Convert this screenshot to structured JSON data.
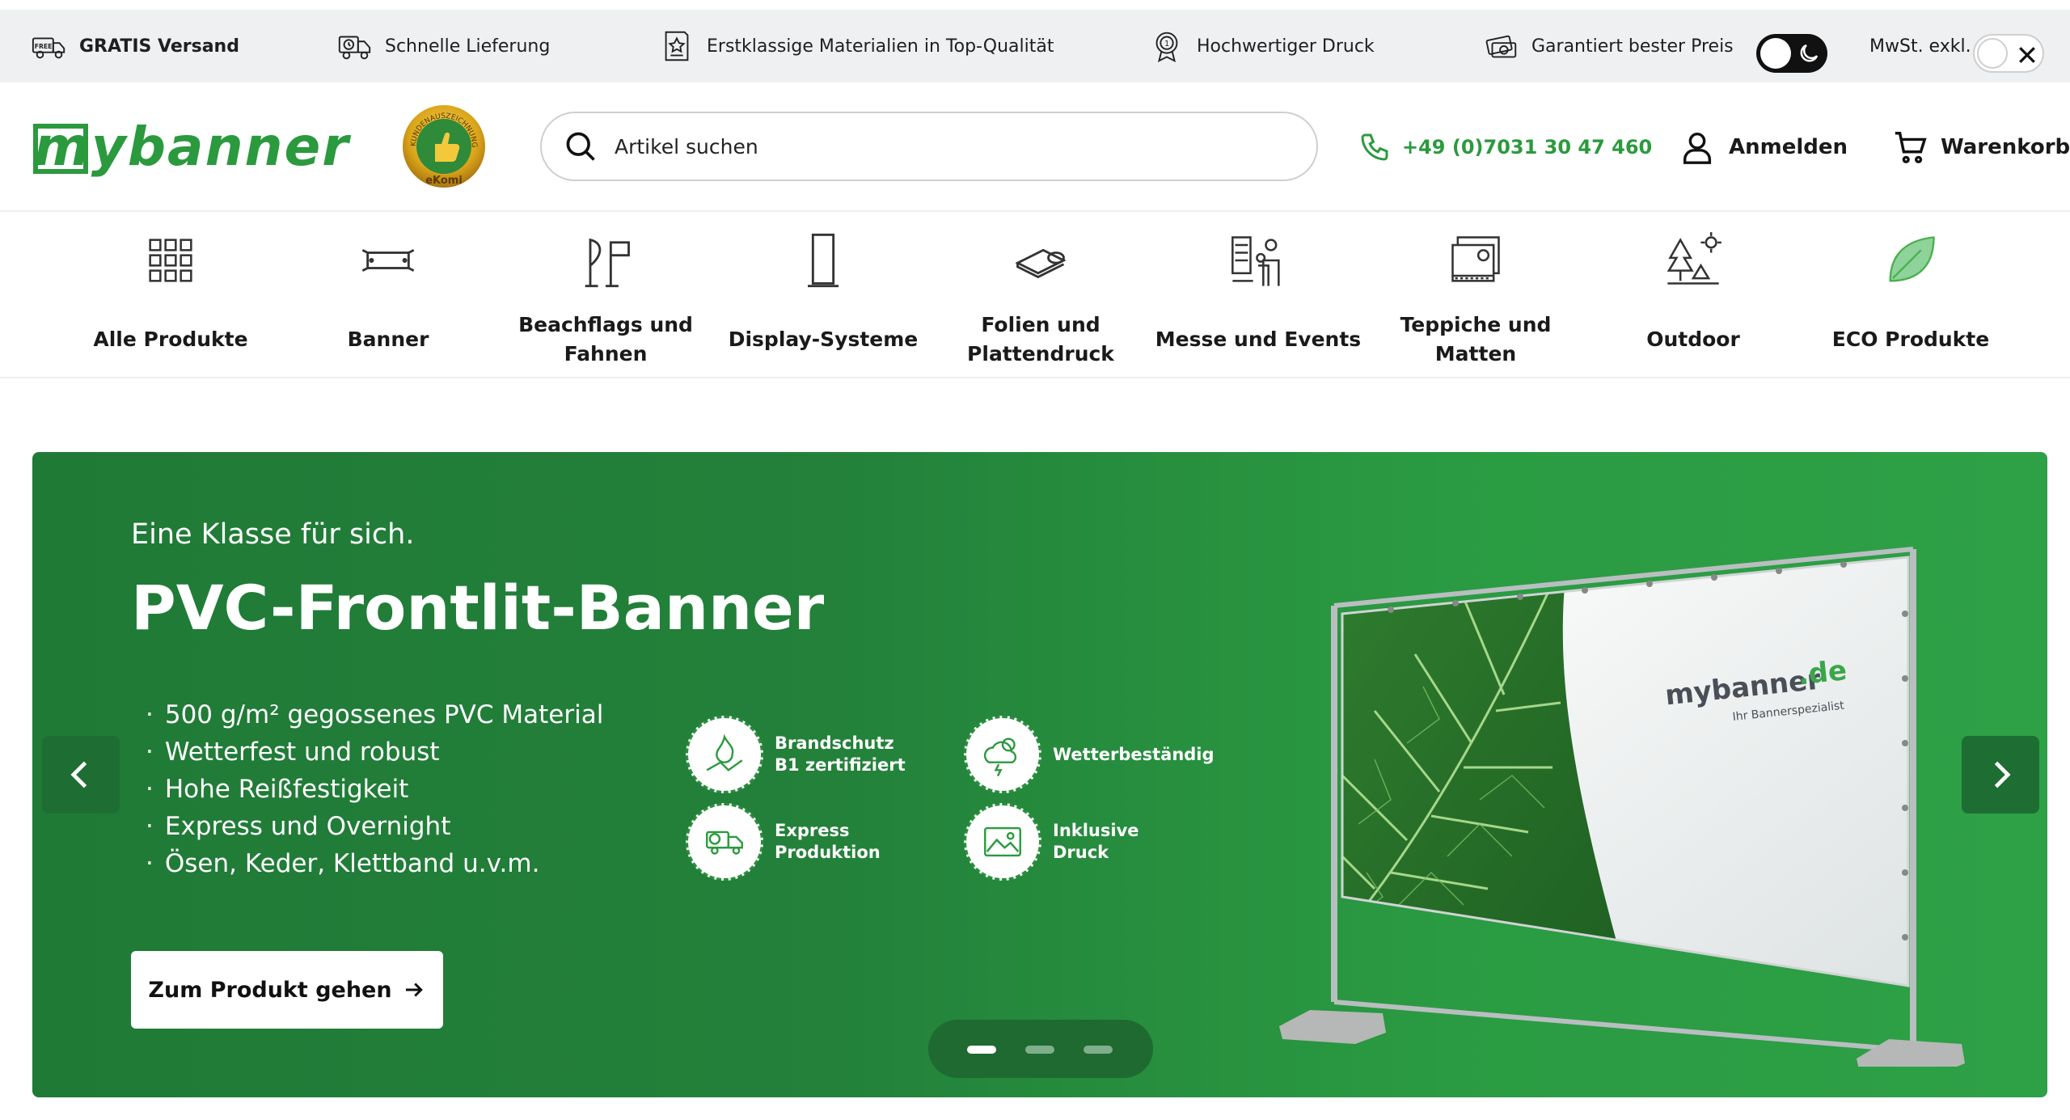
{
  "topbar": {
    "free_badge": "FREE",
    "items": [
      {
        "label": "GRATIS Versand",
        "icon": "free-shipping-truck-icon"
      },
      {
        "label": "Schnelle Lieferung",
        "icon": "fast-delivery-truck-icon"
      },
      {
        "label": "Erstklassige Materialien in Top-Qualität",
        "icon": "certificate-icon"
      },
      {
        "label": "Hochwertiger Druck",
        "icon": "award-medal-icon"
      },
      {
        "label": "Garantiert bester Preis",
        "icon": "price-money-icon"
      }
    ],
    "vat_label": "MwSt. exkl."
  },
  "header": {
    "logo_text": "mybanner",
    "award_text": "KUNDENAUSZEICHNUNG",
    "award_brand": "eKomi",
    "search_placeholder": "Artikel suchen",
    "phone": "+49 (0)7031 30 47 460",
    "login_label": "Anmelden",
    "cart_label": "Warenkorb"
  },
  "categories": [
    {
      "label": "Alle Produkte",
      "icon": "grid-icon"
    },
    {
      "label": "Banner",
      "icon": "banner-icon"
    },
    {
      "label": "Beachflags und Fahnen",
      "icon": "beachflag-icon"
    },
    {
      "label": "Display-Systeme",
      "icon": "rollup-display-icon"
    },
    {
      "label": "Folien und Plattendruck",
      "icon": "foil-roll-icon"
    },
    {
      "label": "Messe und Events",
      "icon": "fair-stand-icon"
    },
    {
      "label": "Teppiche und Matten",
      "icon": "carpet-icon"
    },
    {
      "label": "Outdoor",
      "icon": "trees-icon"
    },
    {
      "label": "ECO Produkte",
      "icon": "leaf-icon"
    }
  ],
  "hero": {
    "eyebrow": "Eine Klasse für sich.",
    "title": "PVC-Frontlit-Banner",
    "bullets": [
      "500 g/m² gegossenes PVC Material",
      "Wetterfest und robust",
      "Hohe Reißfestigkeit",
      "Express und Overnight",
      "Ösen, Keder, Klettband u.v.m."
    ],
    "features": [
      {
        "label": "Brandschutz B1 zertifiziert",
        "icon": "fire-protection-icon"
      },
      {
        "label": "Wetterbeständig",
        "icon": "weather-icon"
      },
      {
        "label": "Express Produktion",
        "icon": "express-truck-icon"
      },
      {
        "label": "Inklusive Druck",
        "icon": "image-print-icon"
      }
    ],
    "cta_label": "Zum Produkt gehen",
    "banner_brand": "mybanner",
    "banner_domain": ".de",
    "banner_tagline": "Ihr Bannerspezialist",
    "slides_total": 3,
    "active_slide": 1
  },
  "colors": {
    "brand_green": "#2b9a3e",
    "hero_green_dark": "#1f7a36",
    "hero_green_light": "#2ea046",
    "topbar_bg": "#eef0f1"
  }
}
